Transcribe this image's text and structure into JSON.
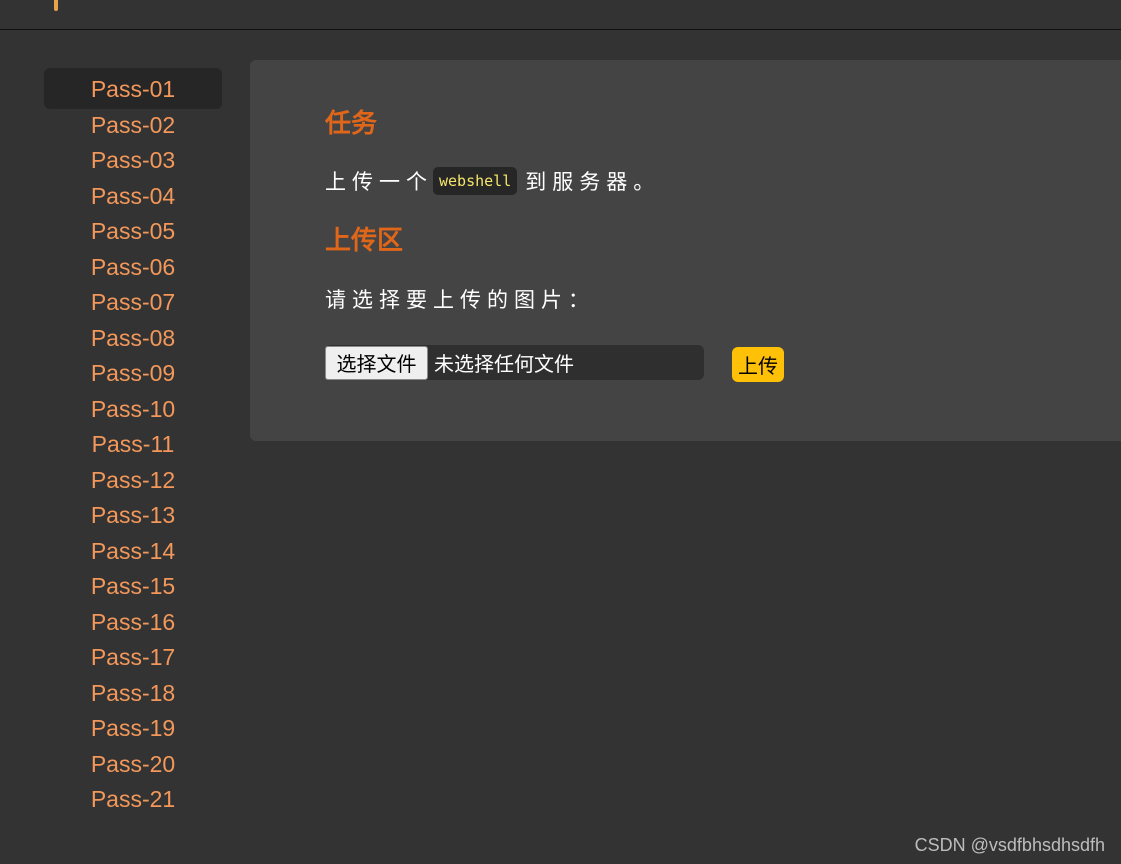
{
  "sidebar": {
    "items": [
      {
        "label": "Pass-01",
        "active": true
      },
      {
        "label": "Pass-02"
      },
      {
        "label": "Pass-03"
      },
      {
        "label": "Pass-04"
      },
      {
        "label": "Pass-05"
      },
      {
        "label": "Pass-06"
      },
      {
        "label": "Pass-07"
      },
      {
        "label": "Pass-08"
      },
      {
        "label": "Pass-09"
      },
      {
        "label": "Pass-10"
      },
      {
        "label": "Pass-11"
      },
      {
        "label": "Pass-12"
      },
      {
        "label": "Pass-13"
      },
      {
        "label": "Pass-14"
      },
      {
        "label": "Pass-15"
      },
      {
        "label": "Pass-16"
      },
      {
        "label": "Pass-17"
      },
      {
        "label": "Pass-18"
      },
      {
        "label": "Pass-19"
      },
      {
        "label": "Pass-20"
      },
      {
        "label": "Pass-21"
      }
    ]
  },
  "main": {
    "task_title": "任务",
    "task_text_before": "上传一个",
    "task_code": "webshell",
    "task_text_after": "到服务器。",
    "upload_title": "上传区",
    "upload_prompt": "请选择要上传的图片：",
    "file_choose_label": "选择文件",
    "file_status": "未选择任何文件",
    "upload_button_label": "上传"
  },
  "watermark": "CSDN @vsdfbhsdhsdfh",
  "colors": {
    "accent": "#f3985a",
    "heading": "#e0661a",
    "button": "#ffc107",
    "code": "#f5e56b"
  }
}
